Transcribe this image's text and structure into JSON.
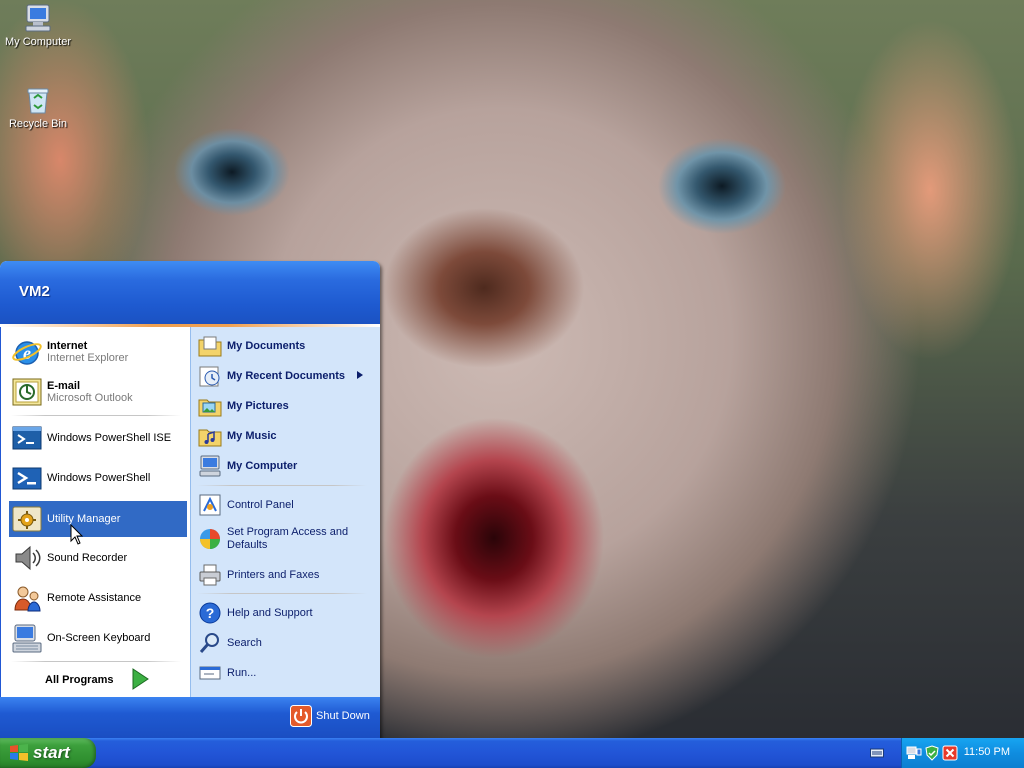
{
  "desktop": {
    "icons": [
      {
        "label": "My Computer",
        "icon": "my-computer-icon"
      },
      {
        "label": "Recycle Bin",
        "icon": "recycle-bin-icon"
      }
    ]
  },
  "start_menu": {
    "user": "VM2",
    "pinned": [
      {
        "label": "Internet",
        "sub": "Internet Explorer",
        "icon": "internet-explorer-icon"
      },
      {
        "label": "E-mail",
        "sub": "Microsoft Outlook",
        "icon": "outlook-icon"
      }
    ],
    "recent": [
      {
        "label": "Windows PowerShell ISE",
        "icon": "powershell-ise-icon"
      },
      {
        "label": "Windows PowerShell",
        "icon": "powershell-icon"
      },
      {
        "label": "Utility Manager",
        "icon": "utility-manager-icon",
        "selected": true
      },
      {
        "label": "Sound Recorder",
        "icon": "sound-recorder-icon"
      },
      {
        "label": "Remote Assistance",
        "icon": "remote-assistance-icon"
      },
      {
        "label": "On-Screen Keyboard",
        "icon": "on-screen-keyboard-icon"
      }
    ],
    "all_programs": "All Programs",
    "places": [
      {
        "label": "My Documents",
        "icon": "my-documents-icon"
      },
      {
        "label": "My Recent Documents",
        "icon": "my-recent-documents-icon",
        "submenu": true
      },
      {
        "label": "My Pictures",
        "icon": "my-pictures-icon"
      },
      {
        "label": "My Music",
        "icon": "my-music-icon"
      },
      {
        "label": "My Computer",
        "icon": "my-computer-icon"
      }
    ],
    "settings": [
      {
        "label": "Control Panel",
        "icon": "control-panel-icon"
      },
      {
        "label": "Set Program Access and Defaults",
        "icon": "set-program-access-icon"
      },
      {
        "label": "Printers and Faxes",
        "icon": "printers-icon"
      }
    ],
    "help": [
      {
        "label": "Help and Support",
        "icon": "help-icon"
      },
      {
        "label": "Search",
        "icon": "search-icon"
      },
      {
        "label": "Run...",
        "icon": "run-icon"
      }
    ],
    "shutdown": "Shut Down"
  },
  "taskbar": {
    "start_label": "start",
    "clock": "11:50 PM"
  },
  "colors": {
    "taskbar_blue": "#245edb",
    "start_green": "#3c9f3c",
    "selection_blue": "#316ac5",
    "tray_blue": "#0f8de0"
  }
}
